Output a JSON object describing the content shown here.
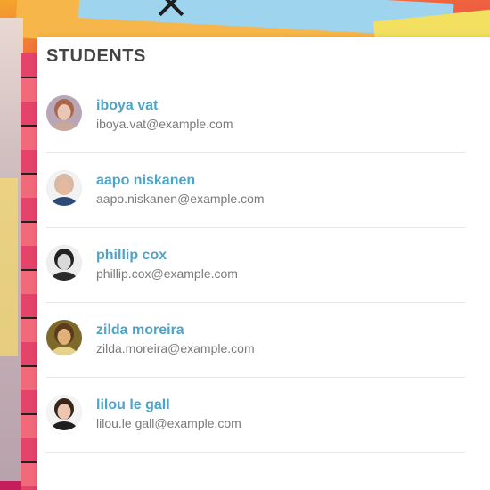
{
  "panel": {
    "title": "STUDENTS"
  },
  "students": [
    {
      "name": "iboya vat",
      "email": "iboya.vat@example.com",
      "avatar": "avatar-woman-blonde",
      "skin": "#e9c7b4",
      "hair": "#a8664a",
      "shirt": "#c9a89a",
      "bg": "#b9a7b8"
    },
    {
      "name": "aapo niskanen",
      "email": "aapo.niskanen@example.com",
      "avatar": "avatar-man-bald",
      "skin": "#e3b9a0",
      "hair": "#d7b8a4",
      "shirt": "#2e4a78",
      "bg": "#f2f2f2"
    },
    {
      "name": "phillip cox",
      "email": "phillip.cox@example.com",
      "avatar": "avatar-man-glasses",
      "skin": "#d9d9d9",
      "hair": "#222222",
      "shirt": "#2b2b2b",
      "bg": "#eeeeee"
    },
    {
      "name": "zilda moreira",
      "email": "zilda.moreira@example.com",
      "avatar": "avatar-woman-curly",
      "skin": "#e0b27a",
      "hair": "#5a3b1c",
      "shirt": "#e6d38a",
      "bg": "#7d6a2a"
    },
    {
      "name": "lilou le gall",
      "email": "lilou.le gall@example.com",
      "avatar": "avatar-woman-dark",
      "skin": "#edc6b2",
      "hair": "#3a2418",
      "shirt": "#1f1f1f",
      "bg": "#f4f4f4"
    }
  ]
}
